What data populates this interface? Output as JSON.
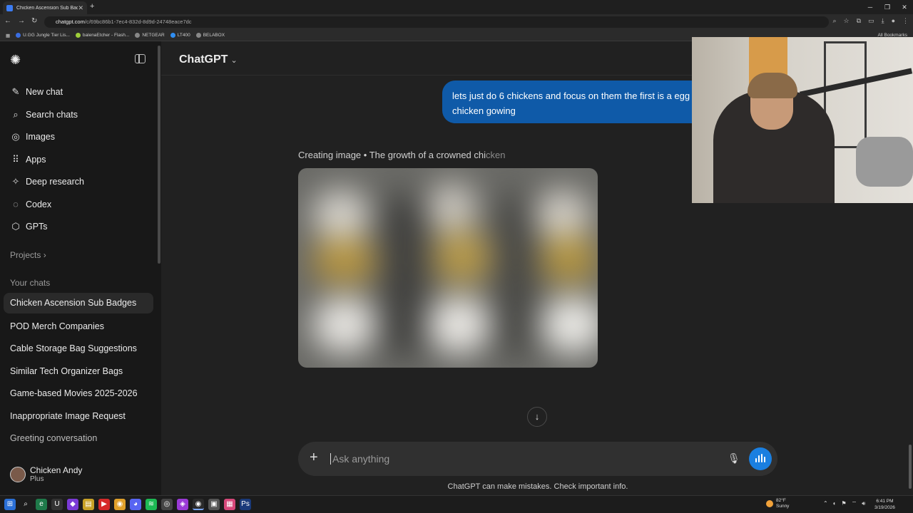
{
  "browser": {
    "tab_title": "Chicken Ascension Sub Badges",
    "new_tab_icon": "+",
    "url_domain": "chatgpt.com",
    "url_path": "/c/69bc86b1-7ec4-832d-8d9d-24748eace7dc",
    "bookmarks": [
      "U.GG Jungle Tier Lis...",
      "balenaEtcher - Flash...",
      "NETGEAR",
      "LT400",
      "BELABOX"
    ],
    "all_bookmarks": "All Bookmarks"
  },
  "sidebar": {
    "nav": [
      {
        "label": "New chat",
        "icon": "✎"
      },
      {
        "label": "Search chats",
        "icon": "⌕"
      },
      {
        "label": "Images",
        "icon": "◎"
      },
      {
        "label": "Apps",
        "icon": "⠿"
      },
      {
        "label": "Deep research",
        "icon": "✧"
      },
      {
        "label": "Codex",
        "icon": "◌"
      },
      {
        "label": "GPTs",
        "icon": "⬡"
      }
    ],
    "projects_label": "Projects",
    "your_chats_label": "Your chats",
    "chats": [
      "Chicken Ascension Sub Badges",
      "POD Merch Companies",
      "Cable Storage Bag Suggestions",
      "Similar Tech Organizer Bags",
      "Game-based Movies 2025-2026",
      "Inappropriate Image Request",
      "Greeting conversation"
    ],
    "user": {
      "name": "Chicken Andy",
      "plan": "Plus"
    }
  },
  "main": {
    "model_name": "ChatGPT",
    "user_message": "lets just do 6 chickens and focus on them the first is a egg chicken gowing",
    "status_prefix": "Creating image • The growth of a crowned chi",
    "status_fade": "cken",
    "composer_placeholder": "Ask anything",
    "disclaimer": "ChatGPT can make mistakes. Check important info."
  },
  "taskbar": {
    "weather_temp": "82°F",
    "weather_text": "Sunny",
    "time": "6:41 PM",
    "date": "3/19/2026"
  },
  "colors": {
    "accent": "#1a7fe0",
    "user_bubble": "#0f5aa8",
    "sidebar_bg": "#181818",
    "main_bg": "#212121"
  }
}
